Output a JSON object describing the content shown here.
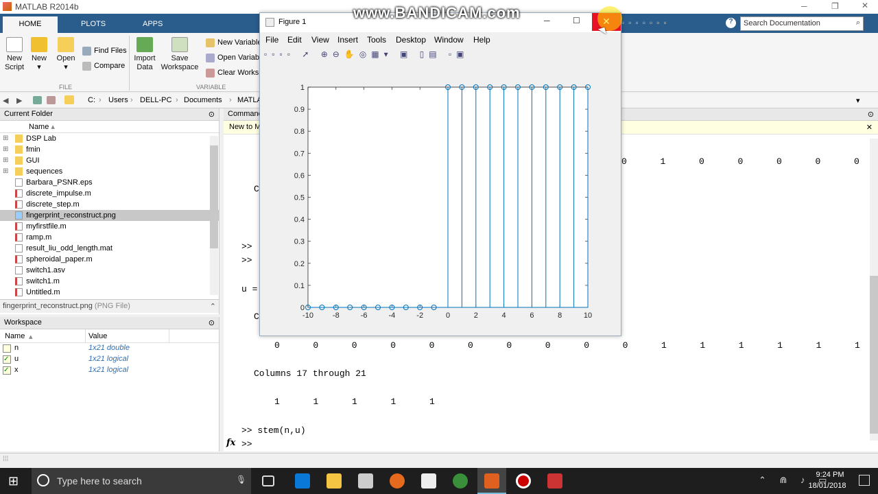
{
  "app_title": "MATLAB R2014b",
  "ribbon": {
    "tabs": [
      "HOME",
      "PLOTS",
      "APPS"
    ],
    "new_script": "New\nScript",
    "new": "New",
    "open": "Open",
    "find_files": "Find Files",
    "compare": "Compare",
    "import_data": "Import\nData",
    "save_workspace": "Save\nWorkspace",
    "new_variable": "New Variable",
    "open_variable": "Open Variable",
    "clear_workspace": "Clear Workspace",
    "file_section": "FILE",
    "variable_section": "VARIABLE"
  },
  "search": {
    "placeholder": "Search Documentation"
  },
  "path": [
    "C:",
    "Users",
    "DELL-PC",
    "Documents",
    "MATLAB"
  ],
  "current_folder": {
    "title": "Current Folder",
    "column": "Name",
    "items": [
      {
        "name": "DSP Lab",
        "type": "folder"
      },
      {
        "name": "fmin",
        "type": "folder"
      },
      {
        "name": "GUI",
        "type": "folder"
      },
      {
        "name": "sequences",
        "type": "folder"
      },
      {
        "name": "Barbara_PSNR.eps",
        "type": "file"
      },
      {
        "name": "discrete_impulse.m",
        "type": "m"
      },
      {
        "name": "discrete_step.m",
        "type": "m"
      },
      {
        "name": "fingerprint_reconstruct.png",
        "type": "png",
        "selected": true
      },
      {
        "name": "myfirstfile.m",
        "type": "m"
      },
      {
        "name": "ramp.m",
        "type": "m"
      },
      {
        "name": "result_liu_odd_length.mat",
        "type": "mat"
      },
      {
        "name": "spheroidal_paper.m",
        "type": "m"
      },
      {
        "name": "switch1.asv",
        "type": "file"
      },
      {
        "name": "switch1.m",
        "type": "m"
      },
      {
        "name": "Untitled.m",
        "type": "m"
      }
    ],
    "details_name": "fingerprint_reconstruct.png",
    "details_type": "(PNG File)"
  },
  "workspace": {
    "title": "Workspace",
    "col_name": "Name",
    "col_value": "Value",
    "vars": [
      {
        "name": "n",
        "value": "1x21 double"
      },
      {
        "name": "u",
        "value": "1x21 logical"
      },
      {
        "name": "x",
        "value": "1x21 logical"
      }
    ]
  },
  "command": {
    "title": "Command Window",
    "new_to": "New to MATLAB?",
    "row1_right": [
      "0",
      "1",
      "0",
      "0",
      "0",
      "0",
      "0"
    ],
    "row2": [
      "0",
      "0",
      "0",
      "0",
      "0",
      "0",
      "0",
      "0",
      "0",
      "0",
      "1",
      "1",
      "1",
      "1",
      "1",
      "1"
    ],
    "columns_text": "Columns 17 through 21",
    "row3": [
      "1",
      "1",
      "1",
      "1",
      "1"
    ],
    "prompt1": ">>",
    "prompt2": ">>",
    "u_eq": "u =",
    "c1": "C",
    "c2": "C",
    "last_cmd": ">> stem(n,u)",
    "current_prompt": ">>",
    "fx": "fx"
  },
  "figure": {
    "title": "Figure 1",
    "menu": [
      "File",
      "Edit",
      "View",
      "Insert",
      "Tools",
      "Desktop",
      "Window",
      "Help"
    ]
  },
  "chart_data": {
    "type": "stem",
    "x": [
      -10,
      -9,
      -8,
      -7,
      -6,
      -5,
      -4,
      -3,
      -2,
      -1,
      0,
      1,
      2,
      3,
      4,
      5,
      6,
      7,
      8,
      9,
      10
    ],
    "values": [
      0,
      0,
      0,
      0,
      0,
      0,
      0,
      0,
      0,
      0,
      1,
      1,
      1,
      1,
      1,
      1,
      1,
      1,
      1,
      1,
      1
    ],
    "xlim": [
      -10,
      10
    ],
    "ylim": [
      0,
      1
    ],
    "xticks": [
      "-10",
      "-8",
      "-6",
      "-4",
      "-2",
      "0",
      "2",
      "4",
      "6",
      "8",
      "10"
    ],
    "yticks": [
      "0",
      "0.1",
      "0.2",
      "0.3",
      "0.4",
      "0.5",
      "0.6",
      "0.7",
      "0.8",
      "0.9",
      "1"
    ],
    "color": "#0072bd"
  },
  "watermark": "www.BANDICAM.com",
  "taskbar": {
    "search": "Type here to search",
    "time": "9:24 PM",
    "date": "18/01/2018"
  }
}
